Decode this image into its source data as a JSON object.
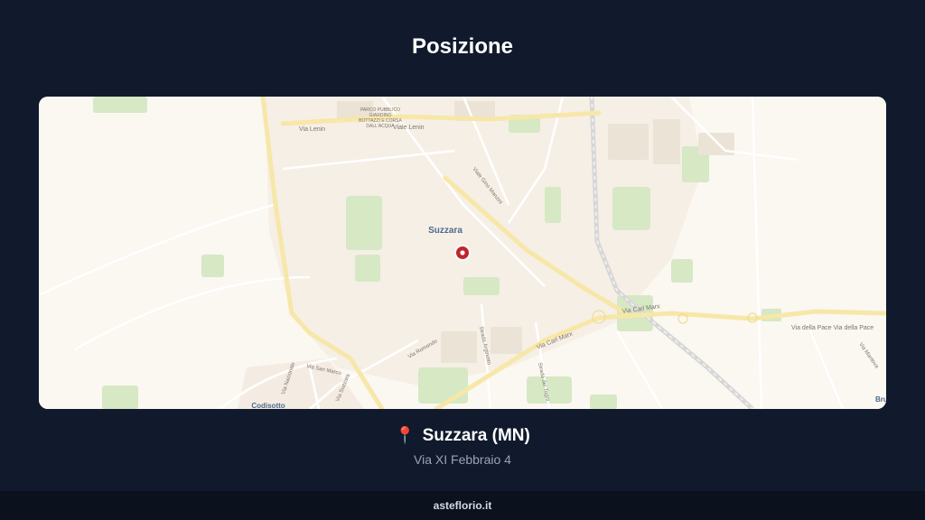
{
  "header": {
    "title": "Posizione"
  },
  "map": {
    "place_label": "Suzzara",
    "bottom_left_label": "Codisotto",
    "edge_label": "Bru",
    "park_label_lines": [
      "PARCO PUBBLICO",
      "GIARDINO",
      "BOTTAZZI E CORSA",
      "DALL'ACQUA"
    ],
    "streets": {
      "via_lenin": "Via Lenin",
      "viale_lenin": "Viale Lenin",
      "viale_zonca": "Viale Gino Manzini",
      "via_carl_marx_1": "Via Carl Marx",
      "via_carl_marx_2": "Via Carl Marx",
      "via_della_pace": "Via della Pace Via della Pace",
      "via_romondo": "Via Romondo",
      "strada_arginotto": "Strada Arginotto",
      "strada_dei_togni": "Strada dei Togni",
      "via_san_marco": "Via San Marco",
      "via_nazionale": "Via Nazionale",
      "via_bassa": "Via Suzzara",
      "via_mantova": "Via Mantova"
    },
    "colors": {
      "background": "#fbf7f1",
      "green": "#d6e8c4",
      "major_road": "#f7e7a8",
      "minor_road": "#ffffff",
      "marker": "#c0262d"
    }
  },
  "location": {
    "pin_icon": "📍",
    "name": "Suzzara (MN)",
    "address": "Via XI Febbraio 4"
  },
  "footer": {
    "brand": "asteflorio.it"
  }
}
